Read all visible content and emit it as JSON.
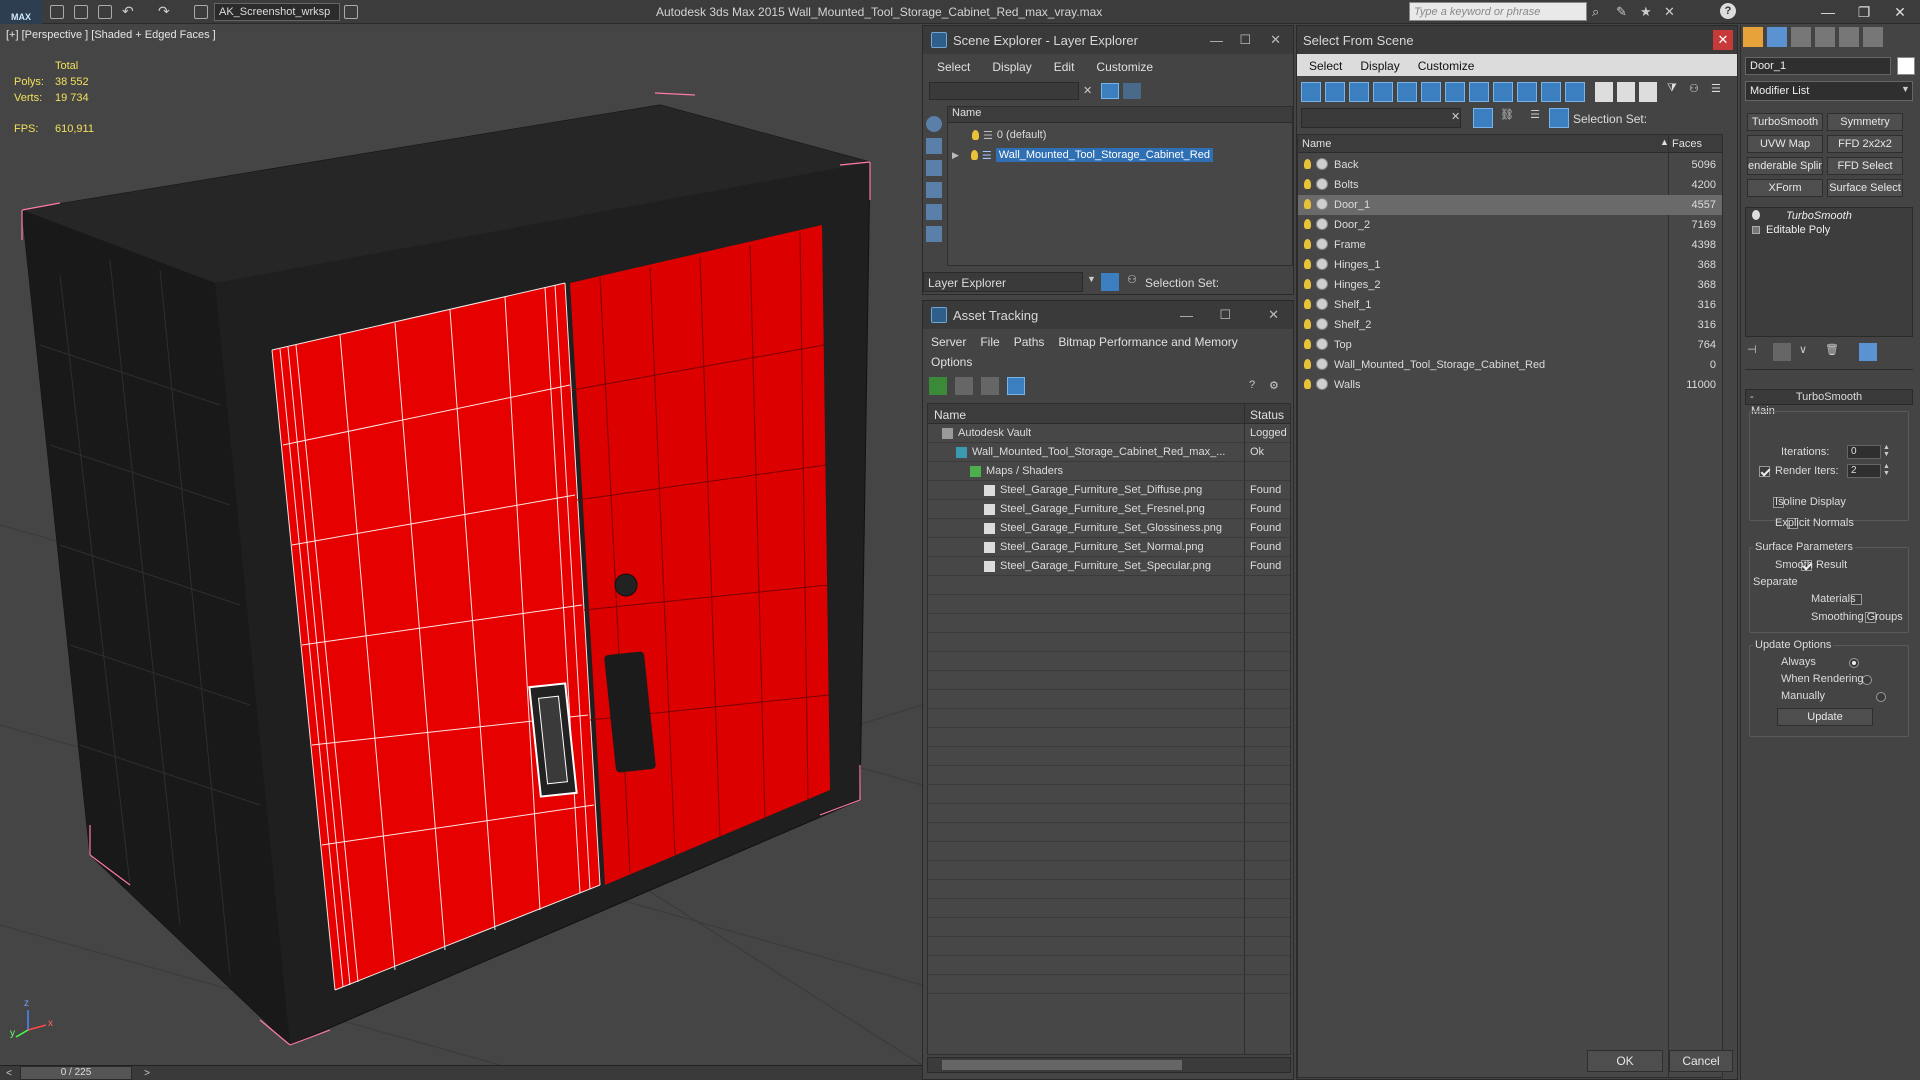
{
  "titlebar": {
    "logo": "MAX",
    "workspace": "AK_Screenshot_wrksp",
    "app_title": "Autodesk 3ds Max  2015     Wall_Mounted_Tool_Storage_Cabinet_Red_max_vray.max",
    "search_placeholder": "Type a keyword or phrase"
  },
  "viewport": {
    "label": "[+] [Perspective ] [Shaded + Edged Faces ]",
    "total_label": "Total",
    "polys_label": "Polys:",
    "polys_value": "38 552",
    "verts_label": "Verts:",
    "verts_value": "19 734",
    "fps_label": "FPS:",
    "fps_value": "610,911",
    "axis_x": "x",
    "axis_y": "y",
    "axis_z": "z"
  },
  "timeslider": {
    "value": "0 / 225",
    "prev": "<",
    "next": ">"
  },
  "scene_explorer": {
    "title": "Scene Explorer - Layer Explorer",
    "menu": [
      "Select",
      "Display",
      "Edit",
      "Customize"
    ],
    "col_name": "Name",
    "layers": [
      {
        "name": "0 (default)",
        "selected": false
      },
      {
        "name": "Wall_Mounted_Tool_Storage_Cabinet_Red",
        "selected": true
      }
    ],
    "footer_dropdown": "Layer Explorer",
    "selection_set_label": "Selection Set:"
  },
  "asset_tracking": {
    "title": "Asset Tracking",
    "menu": [
      "Server",
      "File",
      "Paths",
      "Bitmap Performance and Memory"
    ],
    "menu2": "Options",
    "col_name": "Name",
    "col_status": "Status",
    "rows": [
      {
        "name": "Autodesk Vault",
        "status": "Logged",
        "indent": 0
      },
      {
        "name": "Wall_Mounted_Tool_Storage_Cabinet_Red_max_...",
        "status": "Ok",
        "indent": 1
      },
      {
        "name": "Maps / Shaders",
        "status": "",
        "indent": 2
      },
      {
        "name": "Steel_Garage_Furniture_Set_Diffuse.png",
        "status": "Found",
        "indent": 3
      },
      {
        "name": "Steel_Garage_Furniture_Set_Fresnel.png",
        "status": "Found",
        "indent": 3
      },
      {
        "name": "Steel_Garage_Furniture_Set_Glossiness.png",
        "status": "Found",
        "indent": 3
      },
      {
        "name": "Steel_Garage_Furniture_Set_Normal.png",
        "status": "Found",
        "indent": 3
      },
      {
        "name": "Steel_Garage_Furniture_Set_Specular.png",
        "status": "Found",
        "indent": 3
      }
    ]
  },
  "select_from_scene": {
    "title": "Select From Scene",
    "menu": [
      "Select",
      "Display",
      "Customize"
    ],
    "selection_set_label": "Selection Set:",
    "col_name": "Name",
    "col_faces": "Faces",
    "objects": [
      {
        "name": "Back",
        "faces": "5096",
        "selected": false
      },
      {
        "name": "Bolts",
        "faces": "4200",
        "selected": false
      },
      {
        "name": "Door_1",
        "faces": "4557",
        "selected": true
      },
      {
        "name": "Door_2",
        "faces": "7169",
        "selected": false
      },
      {
        "name": "Frame",
        "faces": "4398",
        "selected": false
      },
      {
        "name": "Hinges_1",
        "faces": "368",
        "selected": false
      },
      {
        "name": "Hinges_2",
        "faces": "368",
        "selected": false
      },
      {
        "name": "Shelf_1",
        "faces": "316",
        "selected": false
      },
      {
        "name": "Shelf_2",
        "faces": "316",
        "selected": false
      },
      {
        "name": "Top",
        "faces": "764",
        "selected": false
      },
      {
        "name": "Wall_Mounted_Tool_Storage_Cabinet_Red",
        "faces": "0",
        "selected": false
      },
      {
        "name": "Walls",
        "faces": "11000",
        "selected": false
      }
    ],
    "ok_label": "OK",
    "cancel_label": "Cancel"
  },
  "command_panel": {
    "object_name": "Door_1",
    "modifier_list": "Modifier List",
    "mod_buttons": [
      "TurboSmooth",
      "Symmetry",
      "UVW Map",
      "FFD 2x2x2",
      "enderable Splir",
      "FFD Select",
      "XForm",
      "Surface Select"
    ],
    "stack": [
      "TurboSmooth",
      "Editable Poly"
    ],
    "rollout_title": "TurboSmooth",
    "main_label": "Main",
    "iterations_label": "Iterations:",
    "iterations_value": "0",
    "render_iters_label": "Render Iters:",
    "render_iters_value": "2",
    "isoline_label": "Isoline Display",
    "explicit_normals_label": "Explicit Normals",
    "surface_params_label": "Surface Parameters",
    "smooth_result_label": "Smooth Result",
    "separate_label": "Separate",
    "materials_label": "Materials",
    "smoothing_groups_label": "Smoothing Groups",
    "update_options_label": "Update Options",
    "always_label": "Always",
    "when_rendering_label": "When Rendering",
    "manually_label": "Manually",
    "update_button": "Update"
  }
}
